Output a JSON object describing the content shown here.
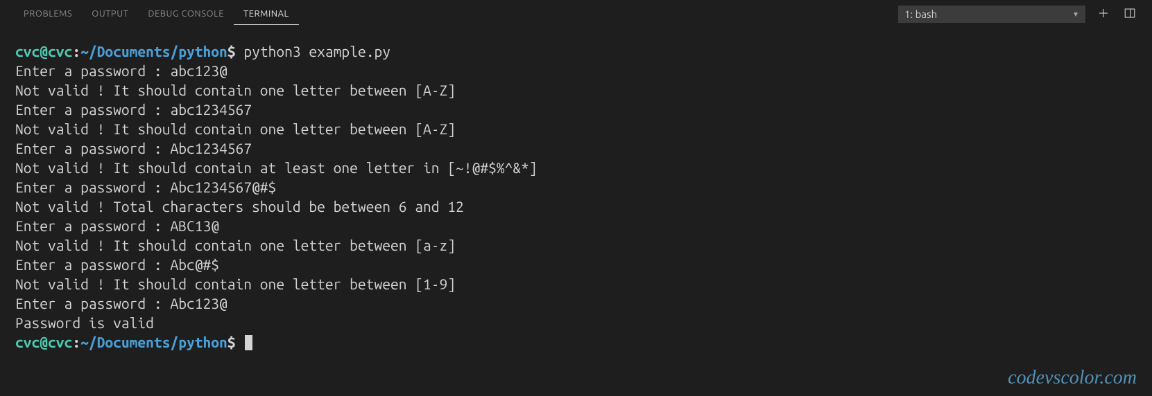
{
  "tabs": {
    "problems": "PROBLEMS",
    "output": "OUTPUT",
    "debug_console": "DEBUG CONSOLE",
    "terminal": "TERMINAL"
  },
  "dropdown": {
    "selected": "1: bash"
  },
  "prompt": {
    "user_host": "cvc@cvc",
    "colon": ":",
    "path": "~/Documents/python",
    "dollar": "$"
  },
  "command": "python3 example.py",
  "output_lines": [
    "Enter a password : abc123@",
    "Not valid ! It should contain one letter between [A-Z]",
    "Enter a password : abc1234567",
    "Not valid ! It should contain one letter between [A-Z]",
    "Enter a password : Abc1234567",
    "Not valid ! It should contain at least one letter in [~!@#$%^&*]",
    "Enter a password : Abc1234567@#$",
    "Not valid ! Total characters should be between 6 and 12",
    "Enter a password : ABC13@",
    "Not valid ! It should contain one letter between [a-z]",
    "Enter a password : Abc@#$",
    "Not valid ! It should contain one letter between [1-9]",
    "Enter a password : Abc123@",
    "Password is valid"
  ],
  "watermark": "codevscolor.com"
}
